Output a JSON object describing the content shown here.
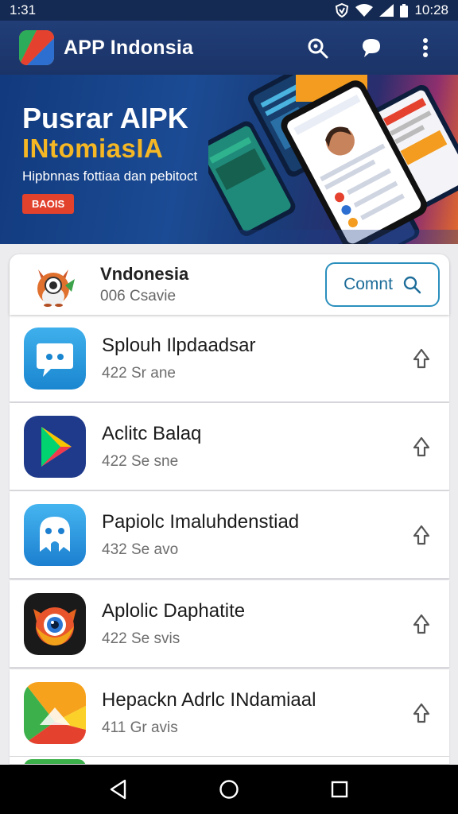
{
  "status_bar": {
    "time_left": "1:31",
    "time_right": "10:28"
  },
  "app_bar": {
    "title": "APP Indonsia"
  },
  "banner": {
    "title_line1": "Pusrar AIPK",
    "title_line2": "INtomiasIA",
    "subtitle": "Hipbnnas fottiaa dan pebitoct",
    "button": "BAOIS"
  },
  "featured": {
    "name": "Vndonesia",
    "sub": "006 Csavie",
    "button": "Comnt"
  },
  "apps": [
    {
      "name": "Splouh Ilpdaadsar",
      "sub": "422 Sr ane"
    },
    {
      "name": "Aclitc Balaq",
      "sub": "422 Se sne"
    },
    {
      "name": "Papiolc Imaluhdenstiad",
      "sub": "432 Se avo"
    },
    {
      "name": "Aplolic Daphatite",
      "sub": "422 Se svis"
    },
    {
      "name": "Hepackn Adrlc INdamiaal",
      "sub": "411 Gr avis"
    }
  ],
  "colors": {
    "app_bar": "#213e78",
    "accent": "#2b8fbd",
    "banner_title_highlight": "#f5b724",
    "banner_button": "#e2412c"
  }
}
